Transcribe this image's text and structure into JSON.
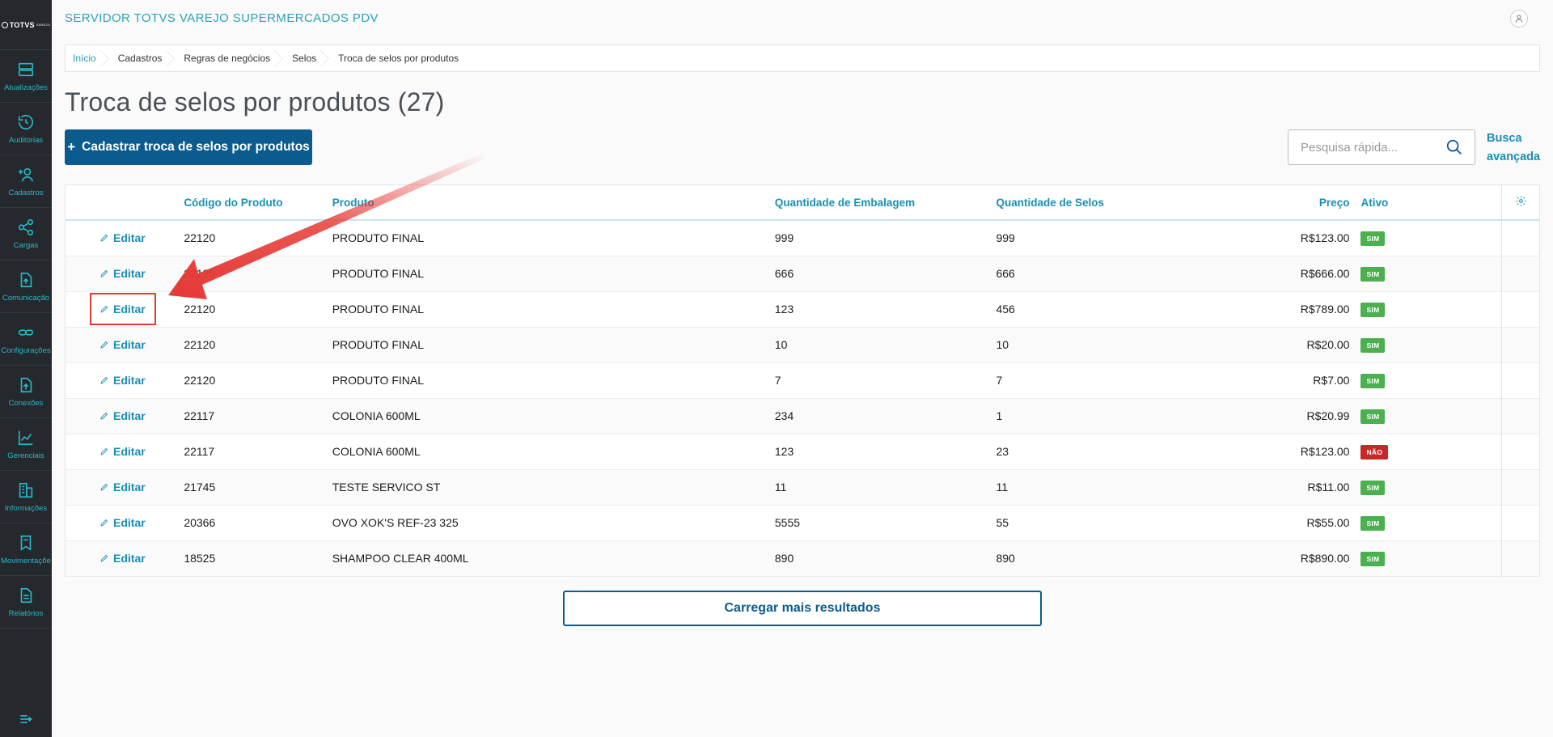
{
  "app": {
    "title": "SERVIDOR TOTVS VAREJO SUPERMERCADOS PDV",
    "logo_text": "TOTVS",
    "logo_sub": "VAREJO"
  },
  "sidebar": {
    "items": [
      {
        "label": "Atualizações",
        "icon": "server-icon"
      },
      {
        "label": "Auditorias",
        "icon": "history-icon"
      },
      {
        "label": "Cadastros",
        "icon": "add-user-icon"
      },
      {
        "label": "Cargas",
        "icon": "share-icon"
      },
      {
        "label": "Comunicação",
        "icon": "upload-file-icon"
      },
      {
        "label": "Configurações",
        "icon": "link-icon"
      },
      {
        "label": "Conexões",
        "icon": "upload-icon"
      },
      {
        "label": "Gerenciais",
        "icon": "chart-icon"
      },
      {
        "label": "Informações",
        "icon": "building-icon"
      },
      {
        "label": "Movimentações",
        "icon": "book-icon"
      },
      {
        "label": "Relatórios",
        "icon": "document-icon"
      }
    ]
  },
  "breadcrumb": [
    "Início",
    "Cadastros",
    "Regras de negócios",
    "Selos",
    "Troca de selos por produtos"
  ],
  "page": {
    "title": "Troca de selos por produtos (27)",
    "add_button": "Cadastrar troca de selos por produtos",
    "search_placeholder": "Pesquisa rápida...",
    "advanced_search": "Busca avançada",
    "load_more": "Carregar mais resultados"
  },
  "table": {
    "headers": {
      "code": "Código do Produto",
      "product": "Produto",
      "pack_qty": "Quantidade de Embalagem",
      "seal_qty": "Quantidade de Selos",
      "price": "Preço",
      "active": "Ativo"
    },
    "edit_label": "Editar",
    "rows": [
      {
        "code": "22120",
        "product": "PRODUTO FINAL",
        "pack_qty": "999",
        "seal_qty": "999",
        "price": "R$123.00",
        "active": "SIM"
      },
      {
        "code": "22120",
        "product": "PRODUTO FINAL",
        "pack_qty": "666",
        "seal_qty": "666",
        "price": "R$666.00",
        "active": "SIM"
      },
      {
        "code": "22120",
        "product": "PRODUTO FINAL",
        "pack_qty": "123",
        "seal_qty": "456",
        "price": "R$789.00",
        "active": "SIM"
      },
      {
        "code": "22120",
        "product": "PRODUTO FINAL",
        "pack_qty": "10",
        "seal_qty": "10",
        "price": "R$20.00",
        "active": "SIM"
      },
      {
        "code": "22120",
        "product": "PRODUTO FINAL",
        "pack_qty": "7",
        "seal_qty": "7",
        "price": "R$7.00",
        "active": "SIM"
      },
      {
        "code": "22117",
        "product": "COLONIA 600ML",
        "pack_qty": "234",
        "seal_qty": "1",
        "price": "R$20.99",
        "active": "SIM"
      },
      {
        "code": "22117",
        "product": "COLONIA 600ML",
        "pack_qty": "123",
        "seal_qty": "23",
        "price": "R$123.00",
        "active": "NÃO"
      },
      {
        "code": "21745",
        "product": "TESTE SERVICO ST",
        "pack_qty": "11",
        "seal_qty": "11",
        "price": "R$11.00",
        "active": "SIM"
      },
      {
        "code": "20366",
        "product": "OVO XOK'S REF-23 325",
        "pack_qty": "5555",
        "seal_qty": "55",
        "price": "R$55.00",
        "active": "SIM"
      },
      {
        "code": "18525",
        "product": "SHAMPOO CLEAR 400ML",
        "pack_qty": "890",
        "seal_qty": "890",
        "price": "R$890.00",
        "active": "SIM"
      }
    ]
  },
  "colors": {
    "sidebar_bg": "#25292e",
    "accent": "#1a8fb3",
    "primary_button": "#0c5b8e",
    "badge_yes": "#4caf50",
    "badge_no": "#c62828",
    "annotation_red": "#e53935"
  }
}
